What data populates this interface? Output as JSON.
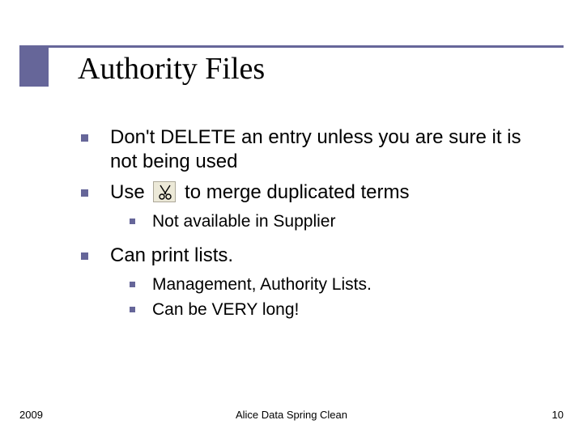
{
  "title": "Authority Files",
  "bullets": {
    "b1": "Don't DELETE an entry unless you are sure it is not being used",
    "b2a": "Use",
    "b2b": "to merge duplicated terms",
    "b2_sub1": "Not available in Supplier",
    "b3": "Can print lists.",
    "b3_sub1": "Management, Authority Lists.",
    "b3_sub2": "Can be VERY long!"
  },
  "icon_name": "scissors-icon",
  "footer": {
    "left": "2009",
    "center": "Alice Data Spring Clean",
    "right": "10"
  }
}
